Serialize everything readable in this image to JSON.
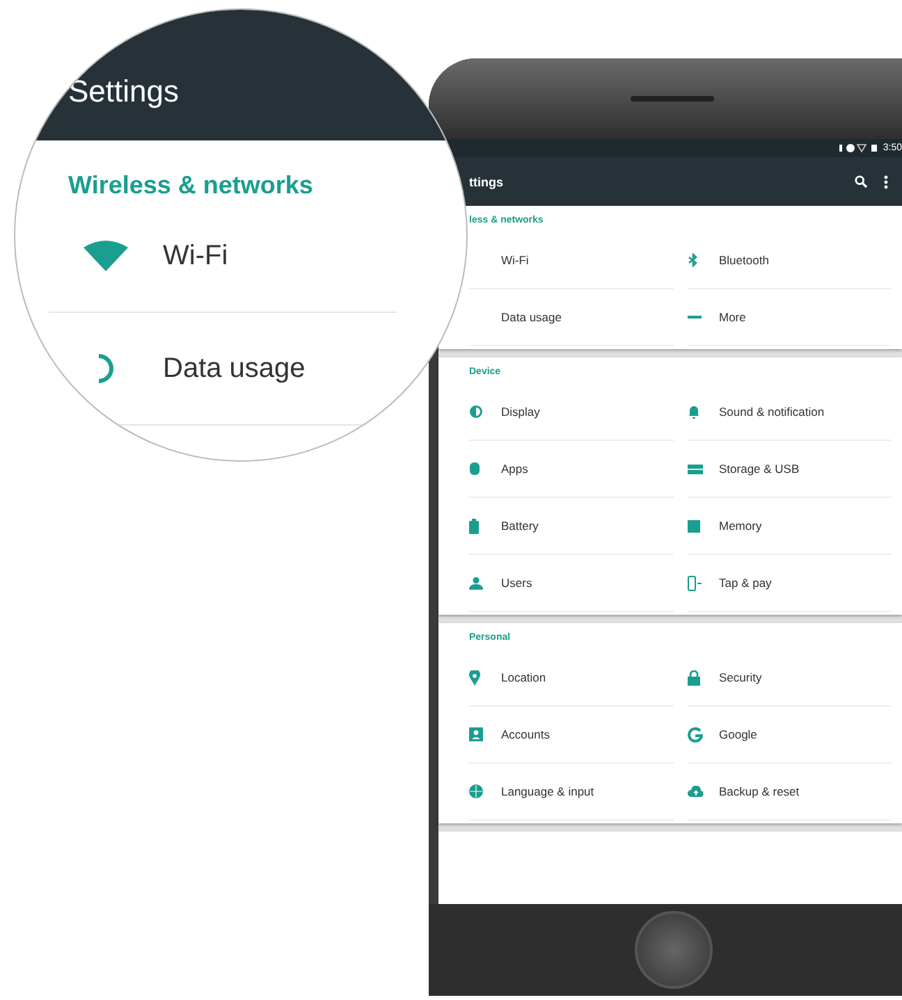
{
  "magnifier": {
    "title": "Settings",
    "section": "Wireless & networks",
    "items": [
      {
        "label": "Wi-Fi"
      },
      {
        "label": "Data usage"
      }
    ]
  },
  "status_bar": {
    "time": "3:50"
  },
  "app_bar": {
    "title": "ttings"
  },
  "sections": [
    {
      "header": "less & networks",
      "items": [
        {
          "label": "Wi-Fi"
        },
        {
          "label": "Bluetooth"
        },
        {
          "label": "Data usage"
        },
        {
          "label": "More"
        }
      ]
    },
    {
      "header": "Device",
      "items": [
        {
          "label": "Display"
        },
        {
          "label": "Sound & notification"
        },
        {
          "label": "Apps"
        },
        {
          "label": "Storage & USB"
        },
        {
          "label": "Battery"
        },
        {
          "label": "Memory"
        },
        {
          "label": "Users"
        },
        {
          "label": "Tap & pay"
        }
      ]
    },
    {
      "header": "Personal",
      "items": [
        {
          "label": "Location"
        },
        {
          "label": "Security"
        },
        {
          "label": "Accounts"
        },
        {
          "label": "Google"
        },
        {
          "label": "Language & input"
        },
        {
          "label": "Backup & reset"
        }
      ]
    }
  ]
}
